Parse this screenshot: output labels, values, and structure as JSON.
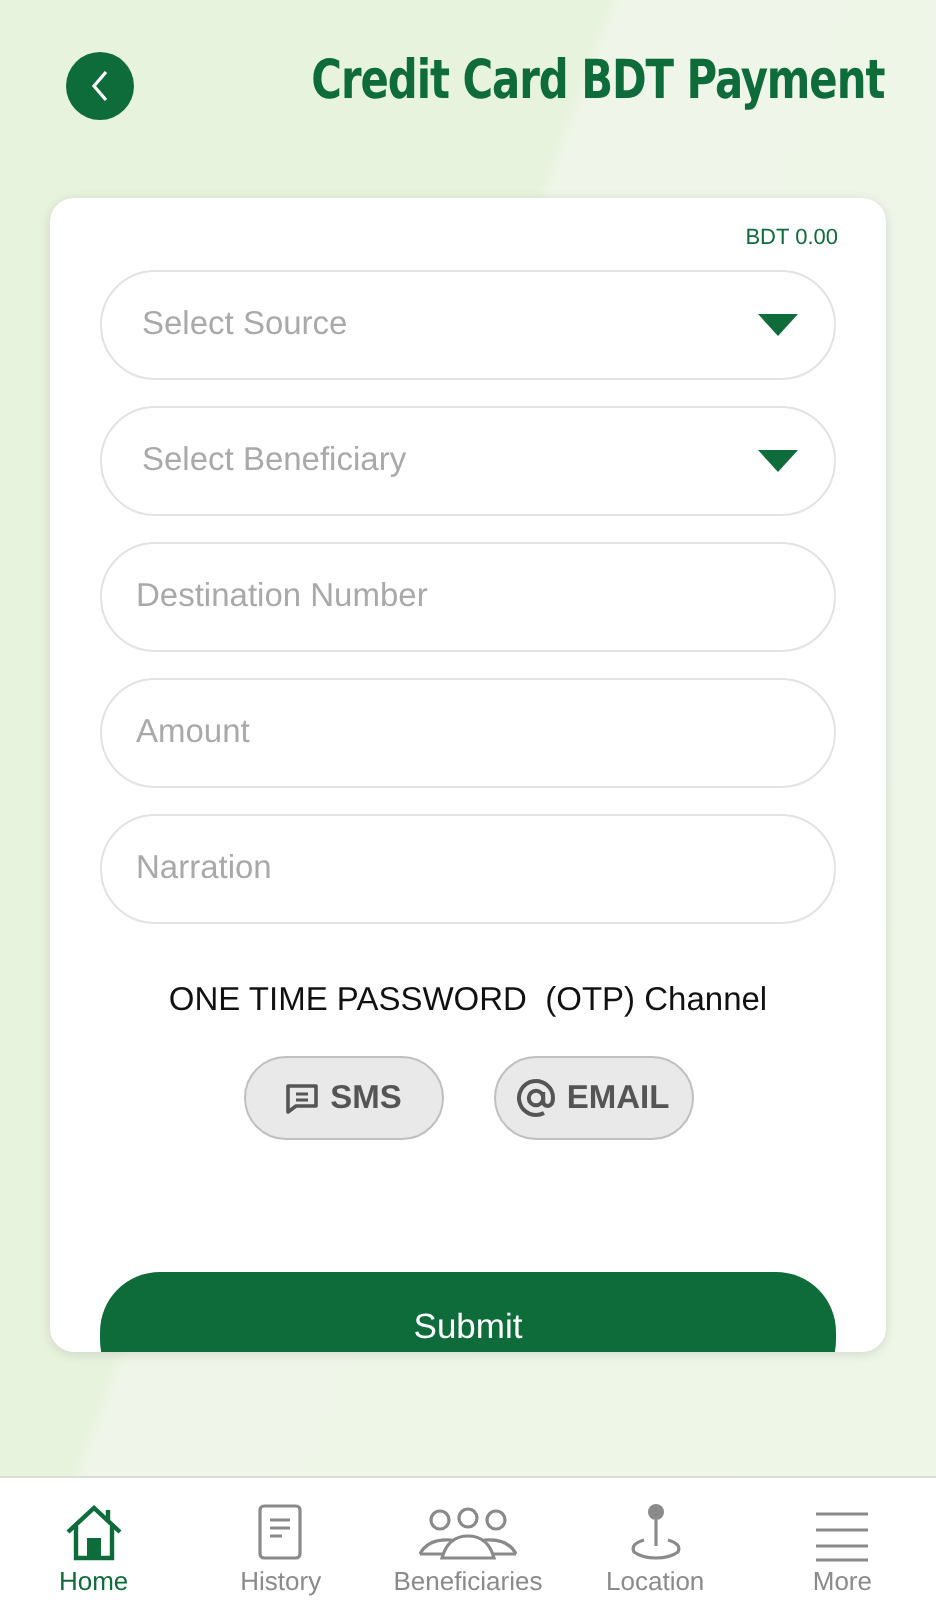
{
  "header": {
    "title": "Credit Card BDT Payment"
  },
  "balance": "BDT 0.00",
  "fields": [
    {
      "kind": "select",
      "placeholder": "Select Source"
    },
    {
      "kind": "select",
      "placeholder": "Select Beneficiary"
    },
    {
      "kind": "input",
      "placeholder": "Destination Number"
    },
    {
      "kind": "input",
      "placeholder": "Amount"
    },
    {
      "kind": "input",
      "placeholder": "Narration"
    }
  ],
  "otp": {
    "label": "ONE TIME PASSWORD  (OTP) Channel",
    "channels": [
      {
        "kind": "sms",
        "label": "SMS",
        "selected": false
      },
      {
        "kind": "email",
        "label": "EMAIL",
        "selected": false
      }
    ]
  },
  "submit": "Submit",
  "nav": [
    {
      "kind": "home",
      "label": "Home",
      "selected": true
    },
    {
      "kind": "history",
      "label": "History",
      "selected": false
    },
    {
      "kind": "beneficiaries",
      "label": "Beneficiaries",
      "selected": false
    },
    {
      "kind": "location",
      "label": "Location",
      "selected": false
    },
    {
      "kind": "more",
      "label": "More",
      "selected": false
    }
  ]
}
